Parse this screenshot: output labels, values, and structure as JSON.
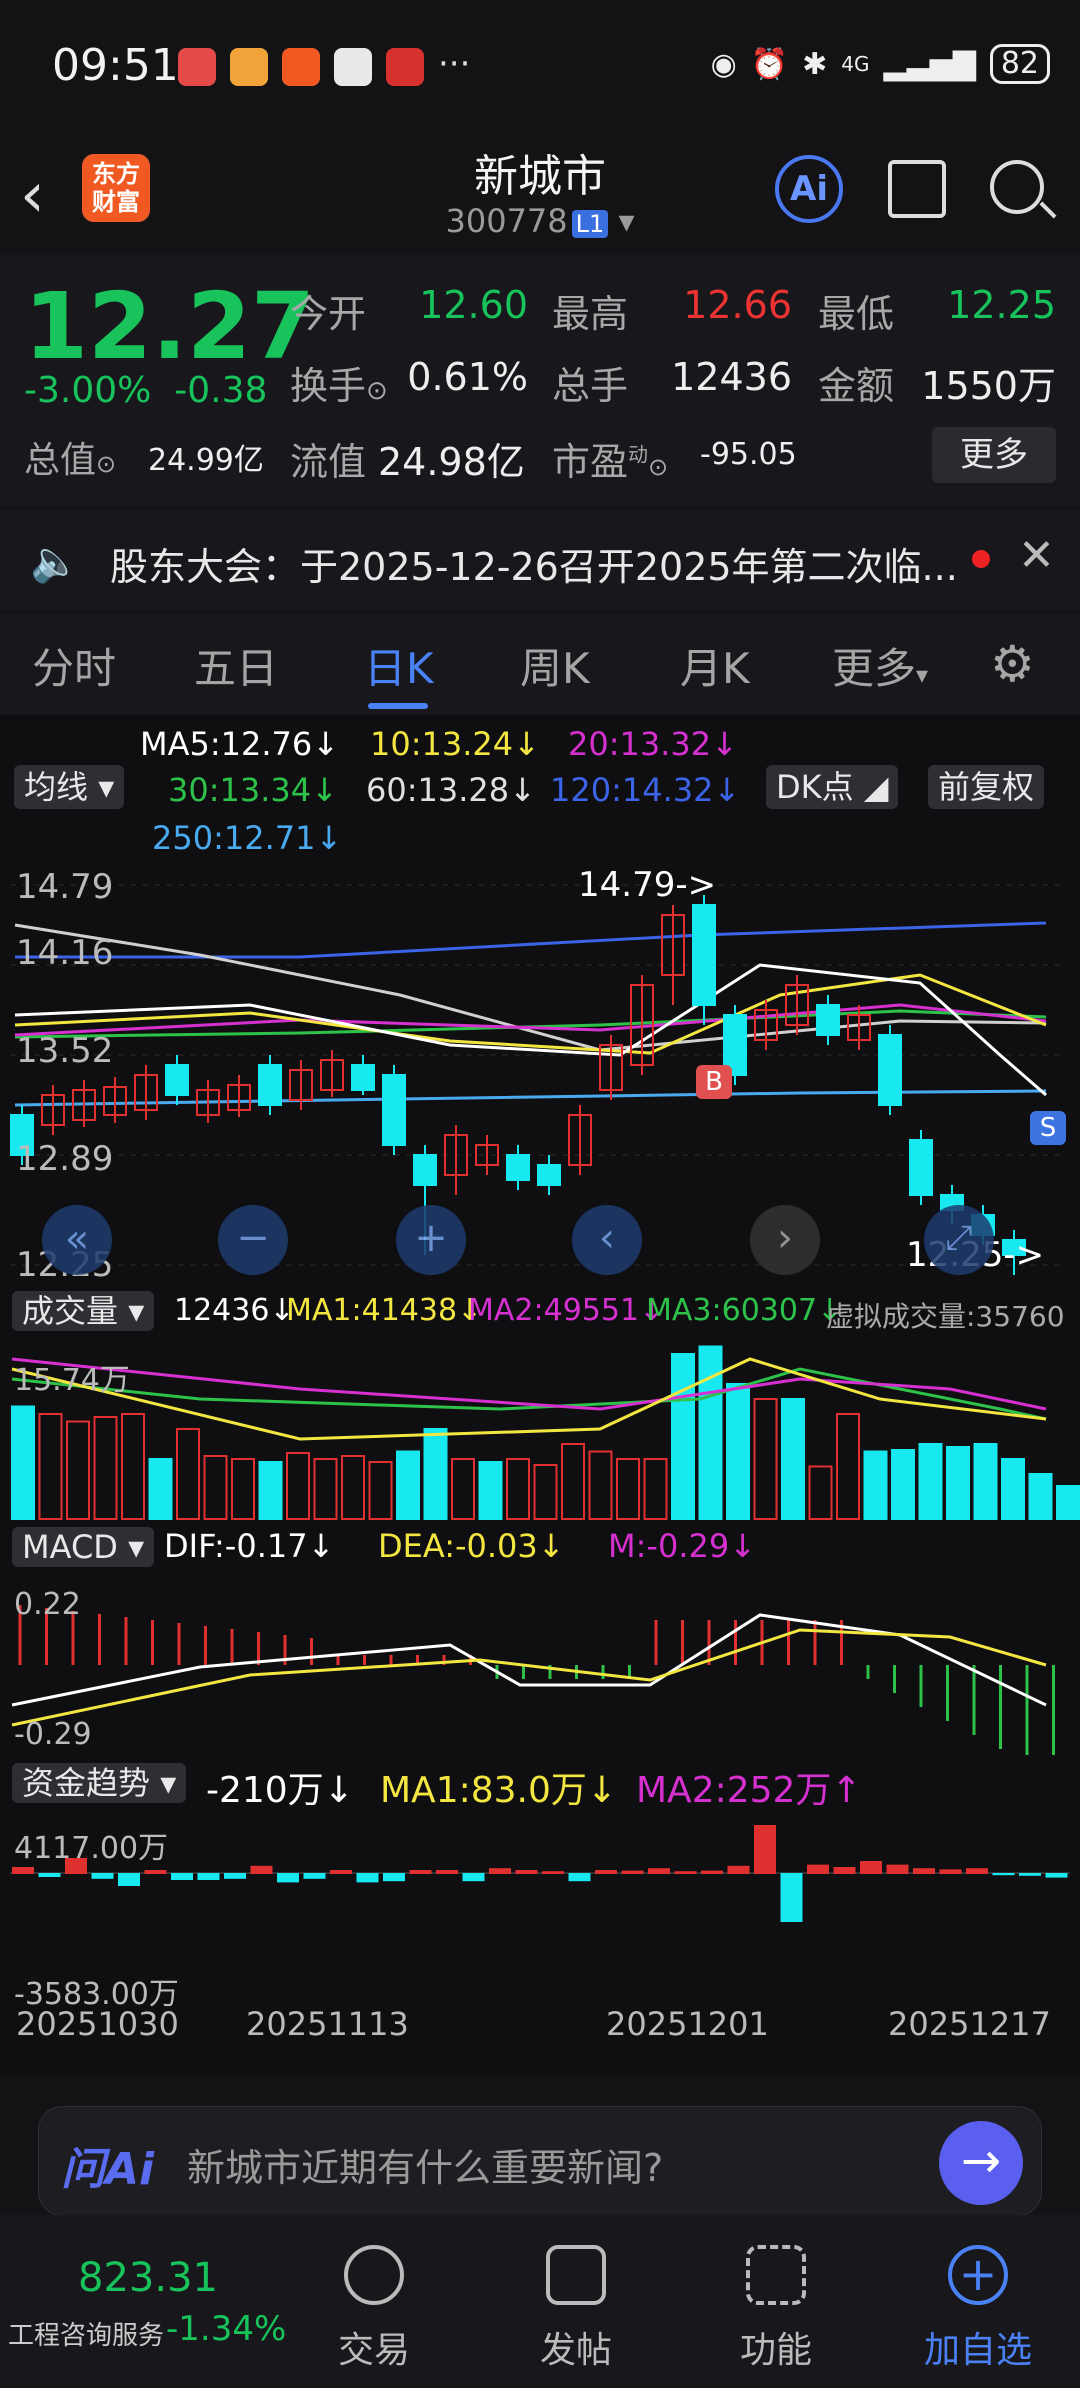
{
  "status": {
    "time": "09:51",
    "network": "4G",
    "battery": "82",
    "dots": "···"
  },
  "header": {
    "title": "新城市",
    "code": "300778",
    "level": "L1",
    "logo": "东方财富",
    "ai": "Ai"
  },
  "quote": {
    "price": "12.27",
    "pct": "-3.00%",
    "change": "-0.38",
    "open_lbl": "今开",
    "open": "12.60",
    "high_lbl": "最高",
    "high": "12.66",
    "low_lbl": "最低",
    "low": "12.25",
    "turnover_lbl": "换手",
    "turnover": "0.61%",
    "vol_lbl": "总手",
    "vol": "12436",
    "amt_lbl": "金额",
    "amt": "1550万",
    "mcap_lbl": "总值",
    "mcap": "24.99亿",
    "float_lbl": "流值",
    "float": "24.98亿",
    "pe_lbl": "市盈",
    "pe_sup": "动",
    "pe": "-95.05",
    "more": "更多"
  },
  "news": {
    "text": "股东大会：于2025-12-26召开2025年第二次临..."
  },
  "tabs": [
    "分时",
    "五日",
    "日K",
    "周K",
    "月K",
    "更多"
  ],
  "ma": {
    "ma5": "MA5:12.76↓",
    "ma10": "10:13.24↓",
    "ma20": "20:13.32↓",
    "ma30": "30:13.34↓",
    "ma60": "60:13.28↓",
    "ma120": "120:14.32↓",
    "ma250": "250:12.71↓",
    "junxian": "均线",
    "dk": "DK点",
    "fq": "前复权"
  },
  "kline": {
    "y_labels": [
      "14.79",
      "14.16",
      "13.52",
      "12.89",
      "12.25"
    ],
    "high_mark": "14.79->",
    "low_mark": "12.25->",
    "b": "B",
    "s": "S"
  },
  "volume": {
    "label": "成交量",
    "v": "12436↓",
    "ma1": "MA1:41438↓",
    "ma2": "MA2:49551↓",
    "ma3": "MA3:60307↓",
    "virtual": "虚拟成交量:35760",
    "top": "15.74万"
  },
  "macd": {
    "label": "MACD",
    "dif": "DIF:-0.17↓",
    "dea": "DEA:-0.03↓",
    "m": "M:-0.29↓",
    "top": "0.22",
    "bottom": "-0.29"
  },
  "fund": {
    "label": "资金趋势",
    "v": "-210万↓",
    "ma1": "MA1:83.0万↓",
    "ma2": "MA2:252万↑",
    "top": "4117.00万",
    "bottom": "-3583.00万"
  },
  "dates": [
    "20251030",
    "20251113",
    "20251201",
    "20251217"
  ],
  "aibar": {
    "logo": "问Ai",
    "placeholder": "新城市近期有什么重要新闻?"
  },
  "bottom": {
    "index_val": "823.31",
    "index_name": "工程咨询服务",
    "index_pct": "-1.34%",
    "trade": "交易",
    "post": "发帖",
    "func": "功能",
    "add": "加自选"
  },
  "chart_data": {
    "type": "candlestick",
    "categories_first": "20251030",
    "categories_last": "20251217",
    "ylim": [
      12.25,
      14.79
    ]
  }
}
